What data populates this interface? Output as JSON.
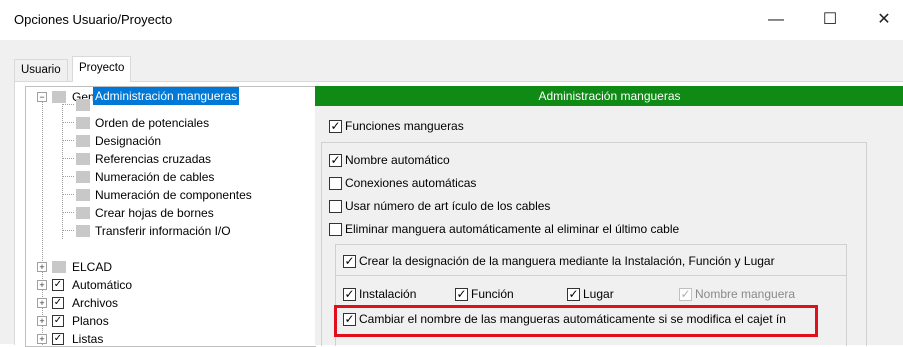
{
  "window": {
    "title": "Opciones Usuario/Proyecto",
    "minimize": "—",
    "maximize": "☐",
    "close": "✕"
  },
  "tabs": [
    {
      "label": "Usuario",
      "active": false
    },
    {
      "label": "Proyecto",
      "active": true
    }
  ],
  "tree": {
    "general": {
      "label": "General",
      "expander": "−"
    },
    "children": [
      {
        "label": "Administración mangueras",
        "selected": true
      },
      {
        "label": "Orden de potenciales"
      },
      {
        "label": "Designación"
      },
      {
        "label": "Referencias cruzadas"
      },
      {
        "label": "Numeración de cables"
      },
      {
        "label": "Numeración de componentes"
      },
      {
        "label": "Crear hojas de bornes"
      },
      {
        "label": "Transferir información I/O"
      }
    ],
    "roots": [
      {
        "label": "ELCAD",
        "expander": "+",
        "checked": false
      },
      {
        "label": "Automático",
        "expander": "+",
        "checked": true
      },
      {
        "label": "Archivos",
        "expander": "+",
        "checked": true
      },
      {
        "label": "Planos",
        "expander": "+",
        "checked": true
      },
      {
        "label": "Listas",
        "expander": "+",
        "checked": true
      }
    ]
  },
  "settings": {
    "header": "Administración mangueras",
    "funciones_mangueras": {
      "label": "Funciones mangueras",
      "checked": true
    },
    "nombre_automatico": {
      "label": "Nombre automático",
      "checked": true
    },
    "conexiones_automaticas": {
      "label": "Conexiones automáticas",
      "checked": false
    },
    "usar_numero_articulo": {
      "label": "Usar número de art ículo de los cables",
      "checked": false
    },
    "eliminar_manguera": {
      "label": "Eliminar manguera automáticamente al eliminar el último cable",
      "checked": false
    },
    "crear_designacion": {
      "label": "Crear la designación de la manguera mediante la Instalación, Función y Lugar",
      "checked": true
    },
    "instalacion": {
      "label": "Instalación",
      "checked": true
    },
    "funcion": {
      "label": "Función",
      "checked": true
    },
    "lugar": {
      "label": "Lugar",
      "checked": true
    },
    "nombre_manguera": {
      "label": "Nombre manguera",
      "checked": true,
      "disabled": true
    },
    "cambiar_nombre": {
      "label": "Cambiar el nombre de las mangueras automáticamente si se modifica el cajet ín",
      "checked": true
    }
  },
  "colors": {
    "header_green": "#0e8a15",
    "selection_blue": "#0078d7",
    "highlight_red": "#e0101a"
  }
}
